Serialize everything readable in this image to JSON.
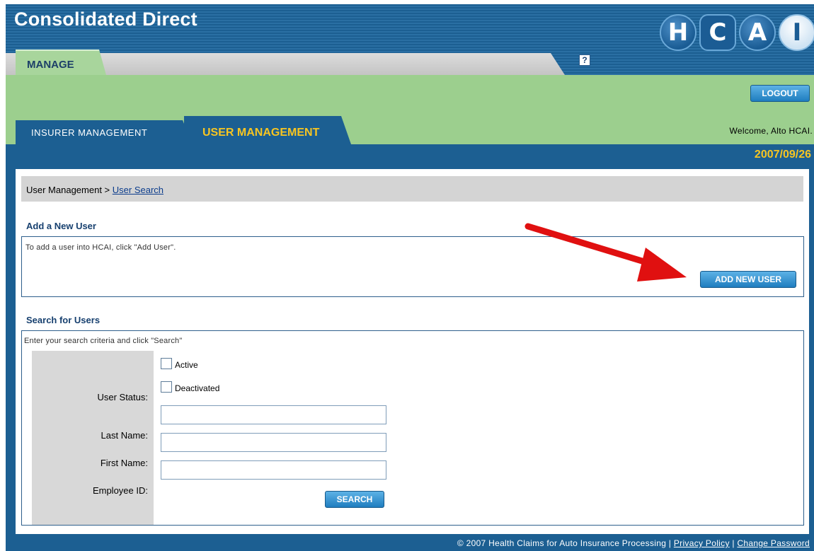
{
  "app": {
    "title": "Consolidated Direct",
    "top_tab": "MANAGE",
    "help_label": "?",
    "logo_letters": [
      "H",
      "C",
      "A",
      "I"
    ]
  },
  "header": {
    "logout_label": "LOGOUT",
    "welcome": "Welcome, Alto HCAI.",
    "tabs": [
      {
        "label": "INSURER MANAGEMENT",
        "active": false
      },
      {
        "label": "USER MANAGEMENT",
        "active": true
      }
    ],
    "date": "2007/09/26"
  },
  "breadcrumb": {
    "root": "User Management > ",
    "link": "User Search"
  },
  "add_user": {
    "title": "Add a New User",
    "description": "To add a user into HCAI, click \"Add User\".",
    "button_label": "ADD NEW USER"
  },
  "search": {
    "title": "Search for Users",
    "description": "Enter your search criteria and click \"Search\"",
    "status_label": "User Status:",
    "status_options": [
      {
        "label": "Active",
        "checked": false
      },
      {
        "label": "Deactivated",
        "checked": false
      }
    ],
    "last_name_label": "Last Name:",
    "last_name_value": "",
    "first_name_label": "First Name:",
    "first_name_value": "",
    "employee_id_label": "Employee ID:",
    "employee_id_value": "",
    "button_label": "SEARCH"
  },
  "footer": {
    "copyright": "© 2007 Health Claims for Auto Insurance Processing | ",
    "privacy_link": "Privacy Policy",
    "separator": " | ",
    "change_password_link": "Change Password"
  },
  "colors": {
    "header_blue": "#1c5f92",
    "band_green": "#9ccf8e",
    "accent_yellow": "#f7c521",
    "button_blue": "#1f7dbf",
    "arrow_red": "#e01010"
  },
  "annotation": {
    "arrow": "red-arrow-pointing-to-add-new-user"
  }
}
